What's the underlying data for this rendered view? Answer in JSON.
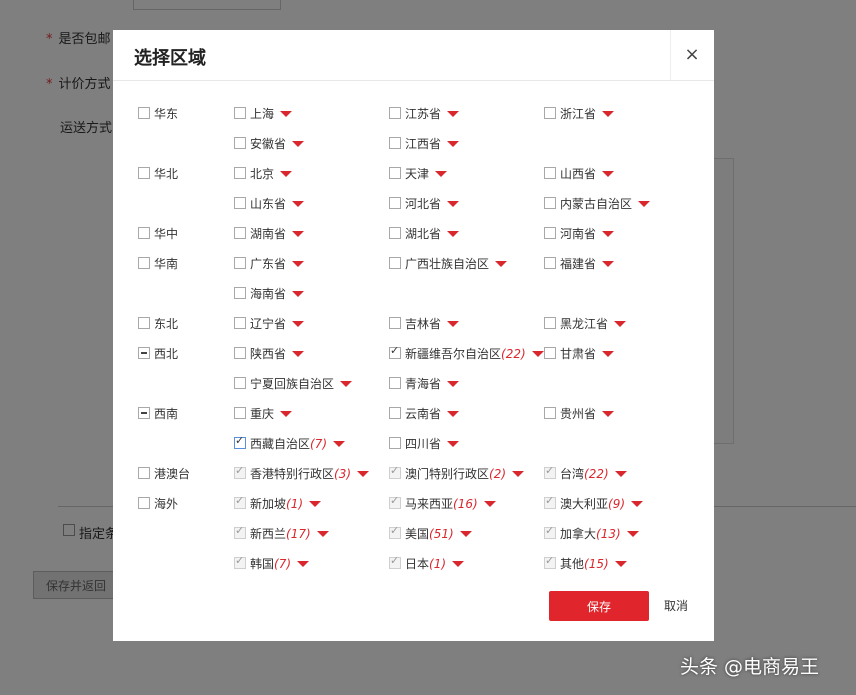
{
  "background": {
    "free_shipping_label": "是否包邮",
    "pricing_label": "计价方式",
    "shipping_label": "运送方式",
    "specify_condition_label": "指定条",
    "save_return_label": "保存并返回",
    "required_mark": "*"
  },
  "modal": {
    "title": "选择区域",
    "close_symbol": "×",
    "save_label": "保存",
    "cancel_label": "取消"
  },
  "regions": [
    {
      "label": "华东",
      "state": "unchecked"
    },
    {
      "label": "华北",
      "state": "unchecked"
    },
    {
      "label": "华中",
      "state": "unchecked"
    },
    {
      "label": "华南",
      "state": "unchecked"
    },
    {
      "label": "东北",
      "state": "unchecked"
    },
    {
      "label": "西北",
      "state": "partial"
    },
    {
      "label": "西南",
      "state": "partial"
    },
    {
      "label": "港澳台",
      "state": "unchecked"
    },
    {
      "label": "海外",
      "state": "unchecked"
    }
  ],
  "provinces": [
    {
      "label": "上海",
      "count": "",
      "state": "unchecked"
    },
    {
      "label": "江苏省",
      "count": "",
      "state": "unchecked"
    },
    {
      "label": "浙江省",
      "count": "",
      "state": "unchecked"
    },
    {
      "label": "安徽省",
      "count": "",
      "state": "unchecked"
    },
    {
      "label": "江西省",
      "count": "",
      "state": "unchecked"
    },
    {
      "label": "北京",
      "count": "",
      "state": "unchecked"
    },
    {
      "label": "天津",
      "count": "",
      "state": "unchecked"
    },
    {
      "label": "山西省",
      "count": "",
      "state": "unchecked"
    },
    {
      "label": "山东省",
      "count": "",
      "state": "unchecked"
    },
    {
      "label": "河北省",
      "count": "",
      "state": "unchecked"
    },
    {
      "label": "内蒙古自治区",
      "count": "",
      "state": "unchecked"
    },
    {
      "label": "湖南省",
      "count": "",
      "state": "unchecked"
    },
    {
      "label": "湖北省",
      "count": "",
      "state": "unchecked"
    },
    {
      "label": "河南省",
      "count": "",
      "state": "unchecked"
    },
    {
      "label": "广东省",
      "count": "",
      "state": "unchecked"
    },
    {
      "label": "广西壮族自治区",
      "count": "",
      "state": "unchecked"
    },
    {
      "label": "福建省",
      "count": "",
      "state": "unchecked"
    },
    {
      "label": "海南省",
      "count": "",
      "state": "unchecked"
    },
    {
      "label": "辽宁省",
      "count": "",
      "state": "unchecked"
    },
    {
      "label": "吉林省",
      "count": "",
      "state": "unchecked"
    },
    {
      "label": "黑龙江省",
      "count": "",
      "state": "unchecked"
    },
    {
      "label": "陕西省",
      "count": "",
      "state": "unchecked"
    },
    {
      "label": "新疆维吾尔自治区",
      "count": "(22)",
      "state": "checked"
    },
    {
      "label": "甘肃省",
      "count": "",
      "state": "unchecked"
    },
    {
      "label": "宁夏回族自治区",
      "count": "",
      "state": "unchecked"
    },
    {
      "label": "青海省",
      "count": "",
      "state": "unchecked"
    },
    {
      "label": "重庆",
      "count": "",
      "state": "unchecked"
    },
    {
      "label": "云南省",
      "count": "",
      "state": "unchecked"
    },
    {
      "label": "贵州省",
      "count": "",
      "state": "unchecked"
    },
    {
      "label": "西藏自治区",
      "count": "(7)",
      "state": "checked-focus"
    },
    {
      "label": "四川省",
      "count": "",
      "state": "unchecked"
    },
    {
      "label": "香港特别行政区",
      "count": "(3)",
      "state": "disabled-checked"
    },
    {
      "label": "澳门特别行政区",
      "count": "(2)",
      "state": "disabled-checked"
    },
    {
      "label": "台湾",
      "count": "(22)",
      "state": "disabled-checked"
    },
    {
      "label": "新加坡",
      "count": "(1)",
      "state": "disabled-checked"
    },
    {
      "label": "马来西亚",
      "count": "(16)",
      "state": "disabled-checked"
    },
    {
      "label": "澳大利亚",
      "count": "(9)",
      "state": "disabled-checked"
    },
    {
      "label": "新西兰",
      "count": "(17)",
      "state": "disabled-checked"
    },
    {
      "label": "美国",
      "count": "(51)",
      "state": "disabled-checked"
    },
    {
      "label": "加拿大",
      "count": "(13)",
      "state": "disabled-checked"
    },
    {
      "label": "韩国",
      "count": "(7)",
      "state": "disabled-checked"
    },
    {
      "label": "日本",
      "count": "(1)",
      "state": "disabled-checked"
    },
    {
      "label": "其他",
      "count": "(15)",
      "state": "disabled-checked"
    }
  ],
  "watermark": "头条 @电商易王"
}
